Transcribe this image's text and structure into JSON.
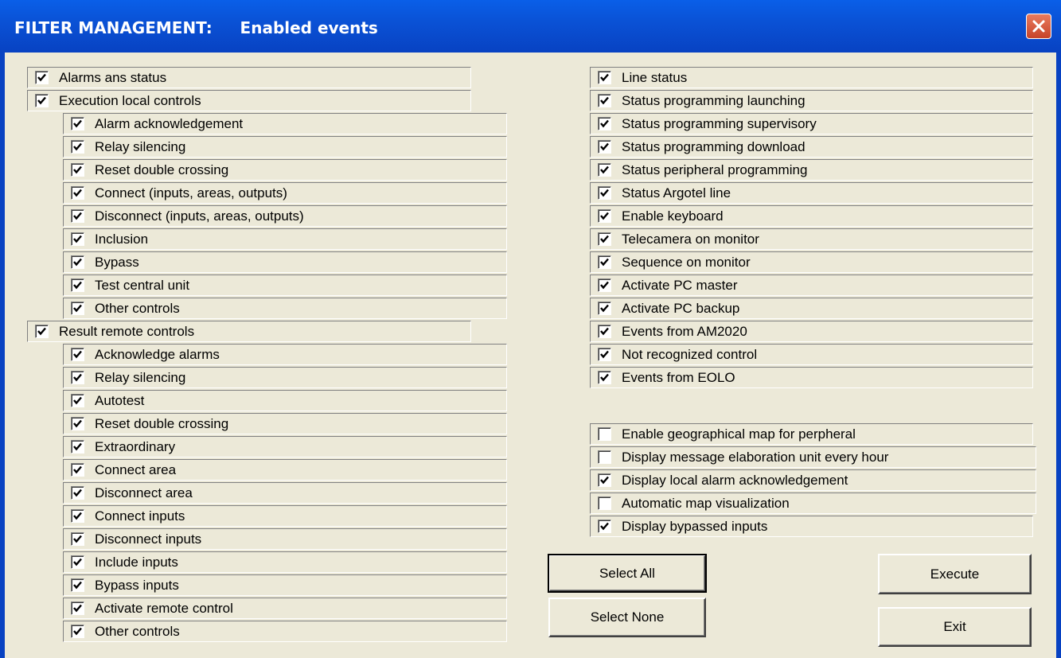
{
  "window": {
    "title": "FILTER MANAGEMENT:     Enabled events",
    "close_icon": "close-icon"
  },
  "left_groups": [
    {
      "label": "Alarms ans status",
      "checked": true
    },
    {
      "label": "Execution local controls",
      "checked": true
    },
    {
      "label": "Alarm acknowledgement",
      "checked": true
    },
    {
      "label": "Relay silencing",
      "checked": true
    },
    {
      "label": "Reset double crossing",
      "checked": true
    },
    {
      "label": "Connect (inputs, areas, outputs)",
      "checked": true
    },
    {
      "label": "Disconnect (inputs, areas, outputs)",
      "checked": true
    },
    {
      "label": "Inclusion",
      "checked": true
    },
    {
      "label": "Bypass",
      "checked": true
    },
    {
      "label": "Test central unit",
      "checked": true
    },
    {
      "label": "Other controls",
      "checked": true
    },
    {
      "label": "Result remote controls",
      "checked": true
    },
    {
      "label": "Acknowledge alarms",
      "checked": true
    },
    {
      "label": "Relay silencing",
      "checked": true
    },
    {
      "label": "Autotest",
      "checked": true
    },
    {
      "label": "Reset double crossing",
      "checked": true
    },
    {
      "label": "Extraordinary",
      "checked": true
    },
    {
      "label": "Connect area",
      "checked": true
    },
    {
      "label": "Disconnect area",
      "checked": true
    },
    {
      "label": "Connect inputs",
      "checked": true
    },
    {
      "label": "Disconnect inputs",
      "checked": true
    },
    {
      "label": "Include inputs",
      "checked": true
    },
    {
      "label": "Bypass inputs",
      "checked": true
    },
    {
      "label": "Activate remote control",
      "checked": true
    },
    {
      "label": "Other controls",
      "checked": true
    }
  ],
  "right_events": [
    {
      "label": "Line status",
      "checked": true
    },
    {
      "label": "Status programming launching",
      "checked": true
    },
    {
      "label": "Status programming supervisory",
      "checked": true
    },
    {
      "label": "Status programming download",
      "checked": true
    },
    {
      "label": "Status peripheral programming",
      "checked": true
    },
    {
      "label": "Status Argotel line",
      "checked": true
    },
    {
      "label": "Enable keyboard",
      "checked": true
    },
    {
      "label": "Telecamera on monitor",
      "checked": true
    },
    {
      "label": "Sequence on monitor",
      "checked": true
    },
    {
      "label": "Activate PC master",
      "checked": true
    },
    {
      "label": "Activate PC backup",
      "checked": true
    },
    {
      "label": "Events from AM2020",
      "checked": true
    },
    {
      "label": "Not recognized control",
      "checked": true
    },
    {
      "label": "Events from EOLO",
      "checked": true
    }
  ],
  "right_options": [
    {
      "label": "Enable geographical map for perpheral",
      "checked": false
    },
    {
      "label": "Display message elaboration unit every hour",
      "checked": false
    },
    {
      "label": "Display local alarm acknowledgement",
      "checked": true
    },
    {
      "label": "Automatic map visualization",
      "checked": false
    },
    {
      "label": "Display bypassed inputs",
      "checked": true
    }
  ],
  "buttons": {
    "select_all": "Select All",
    "select_none": "Select None",
    "execute": "Execute",
    "exit": "Exit"
  },
  "colors": {
    "titlebar": "#0A52D6",
    "dialog_bg": "#ECE9D8",
    "close_button": "#C7442A"
  }
}
